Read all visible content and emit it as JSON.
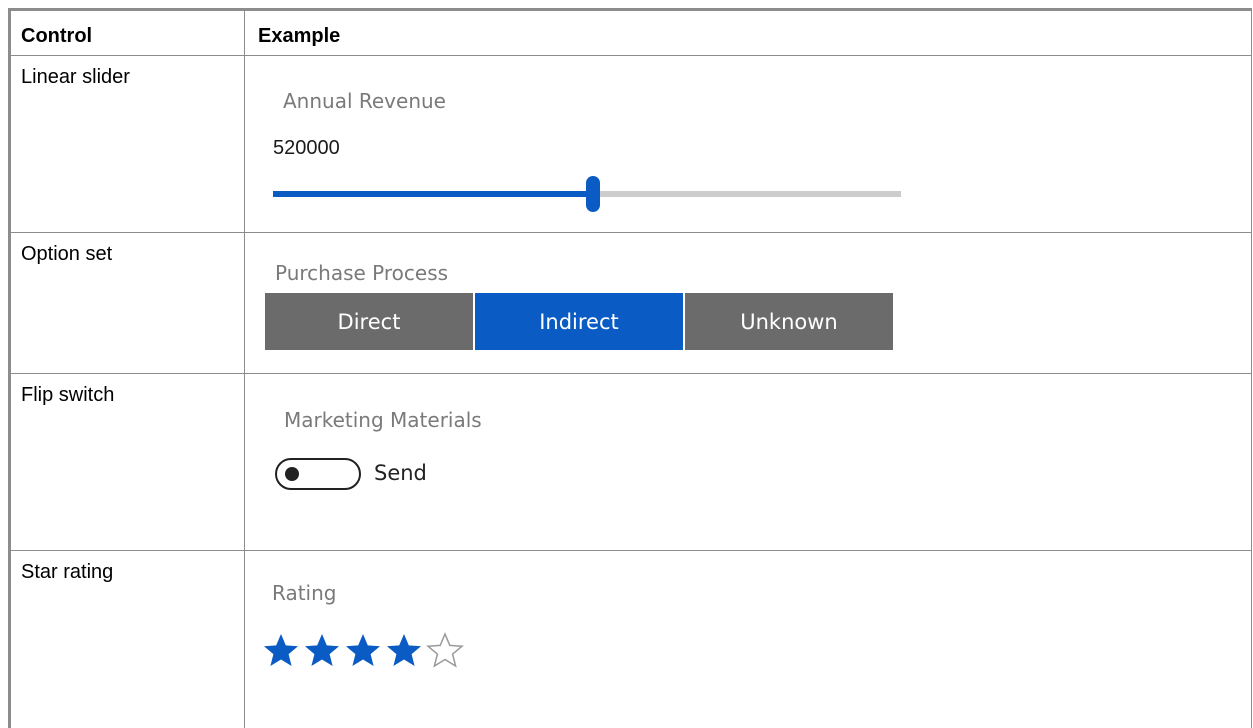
{
  "header": {
    "control": "Control",
    "example": "Example"
  },
  "rows": [
    {
      "name": "Linear slider",
      "field_label": "Annual Revenue",
      "value": "520000",
      "fraction": 0.51
    },
    {
      "name": "Option set",
      "field_label": "Purchase Process",
      "options": [
        "Direct",
        "Indirect",
        "Unknown"
      ],
      "selected": "Indirect"
    },
    {
      "name": "Flip switch",
      "field_label": "Marketing Materials",
      "switch_label": "Send",
      "switch_on": false
    },
    {
      "name": "Star rating",
      "field_label": "Rating",
      "rating": 4,
      "max_rating": 5
    }
  ],
  "colors": {
    "accent": "#0a5bc4",
    "option_bg": "#6b6b6b",
    "track": "#cccccc",
    "label": "#7a7a7a"
  },
  "icons": {
    "filled_star": "star-filled-icon",
    "empty_star": "star-outline-icon"
  }
}
